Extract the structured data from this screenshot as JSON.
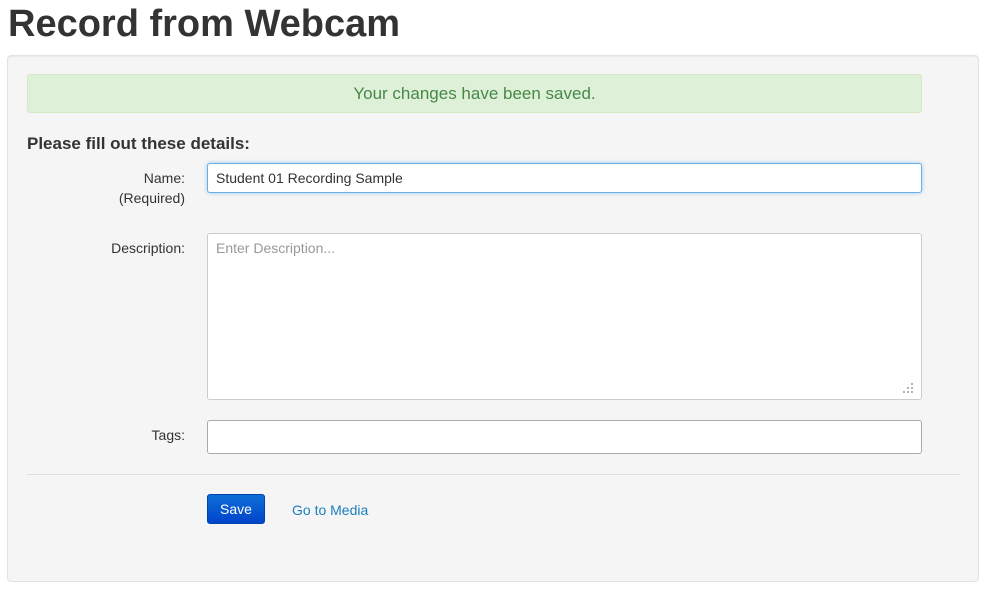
{
  "header": {
    "title": "Record from Webcam"
  },
  "alert": {
    "message": "Your changes have been saved."
  },
  "form": {
    "heading": "Please fill out these details:",
    "name": {
      "label": "Name:",
      "required_note": "(Required)",
      "value": "Student 01 Recording Sample"
    },
    "description": {
      "label": "Description:",
      "value": "",
      "placeholder": "Enter Description..."
    },
    "tags": {
      "label": "Tags:",
      "value": ""
    },
    "save_label": "Save",
    "go_to_media_label": "Go to Media"
  },
  "colors": {
    "alert_bg": "#dff0d8",
    "alert_text": "#468847",
    "primary_button": "#0044cc",
    "link": "#1a7fbf",
    "focus_border": "#66afe9"
  }
}
